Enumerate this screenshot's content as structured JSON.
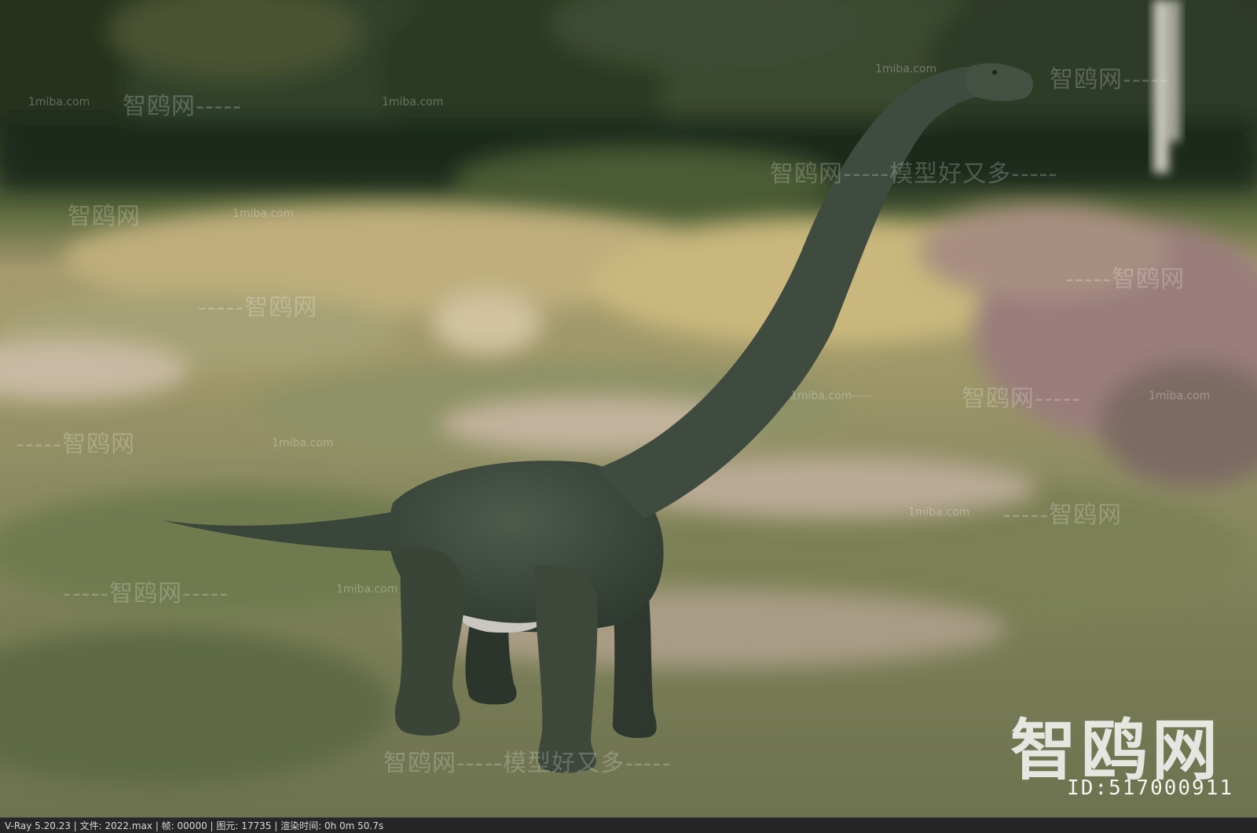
{
  "watermarks": {
    "site": "1miba.com",
    "logo_dashes_right": "智鸥网-----",
    "logo_dashes_left": "-----智鸥网",
    "logo_plain": "智鸥网",
    "logo_with_site": "1miba.com-----智鸥网",
    "slogan_long": "智鸥网-----模型好又多-----",
    "slogan_mid": "智鸥网-----模型好又多-",
    "logo_between_sites": "智鸥网-----1miba.com",
    "site_dashes": "1miba.com-----",
    "dashes_logo_dashes": "-----智鸥网-----",
    "big_logo": "智鸥网",
    "id_label": "ID:517000911"
  },
  "status_bar": {
    "text": "V-Ray 5.20.23 | 文件: 2022.max | 帧: 00000 | 图元: 17735 | 渲染时间: 0h  0m 50.7s"
  },
  "scene": {
    "subject": "sauropod-dinosaur",
    "colors": {
      "forest": "#2f3d26",
      "meadow": "#a59a6e",
      "path": "#c8b69c",
      "heather": "#9a7d7c",
      "dinosaur": "#3e4a3d"
    }
  }
}
